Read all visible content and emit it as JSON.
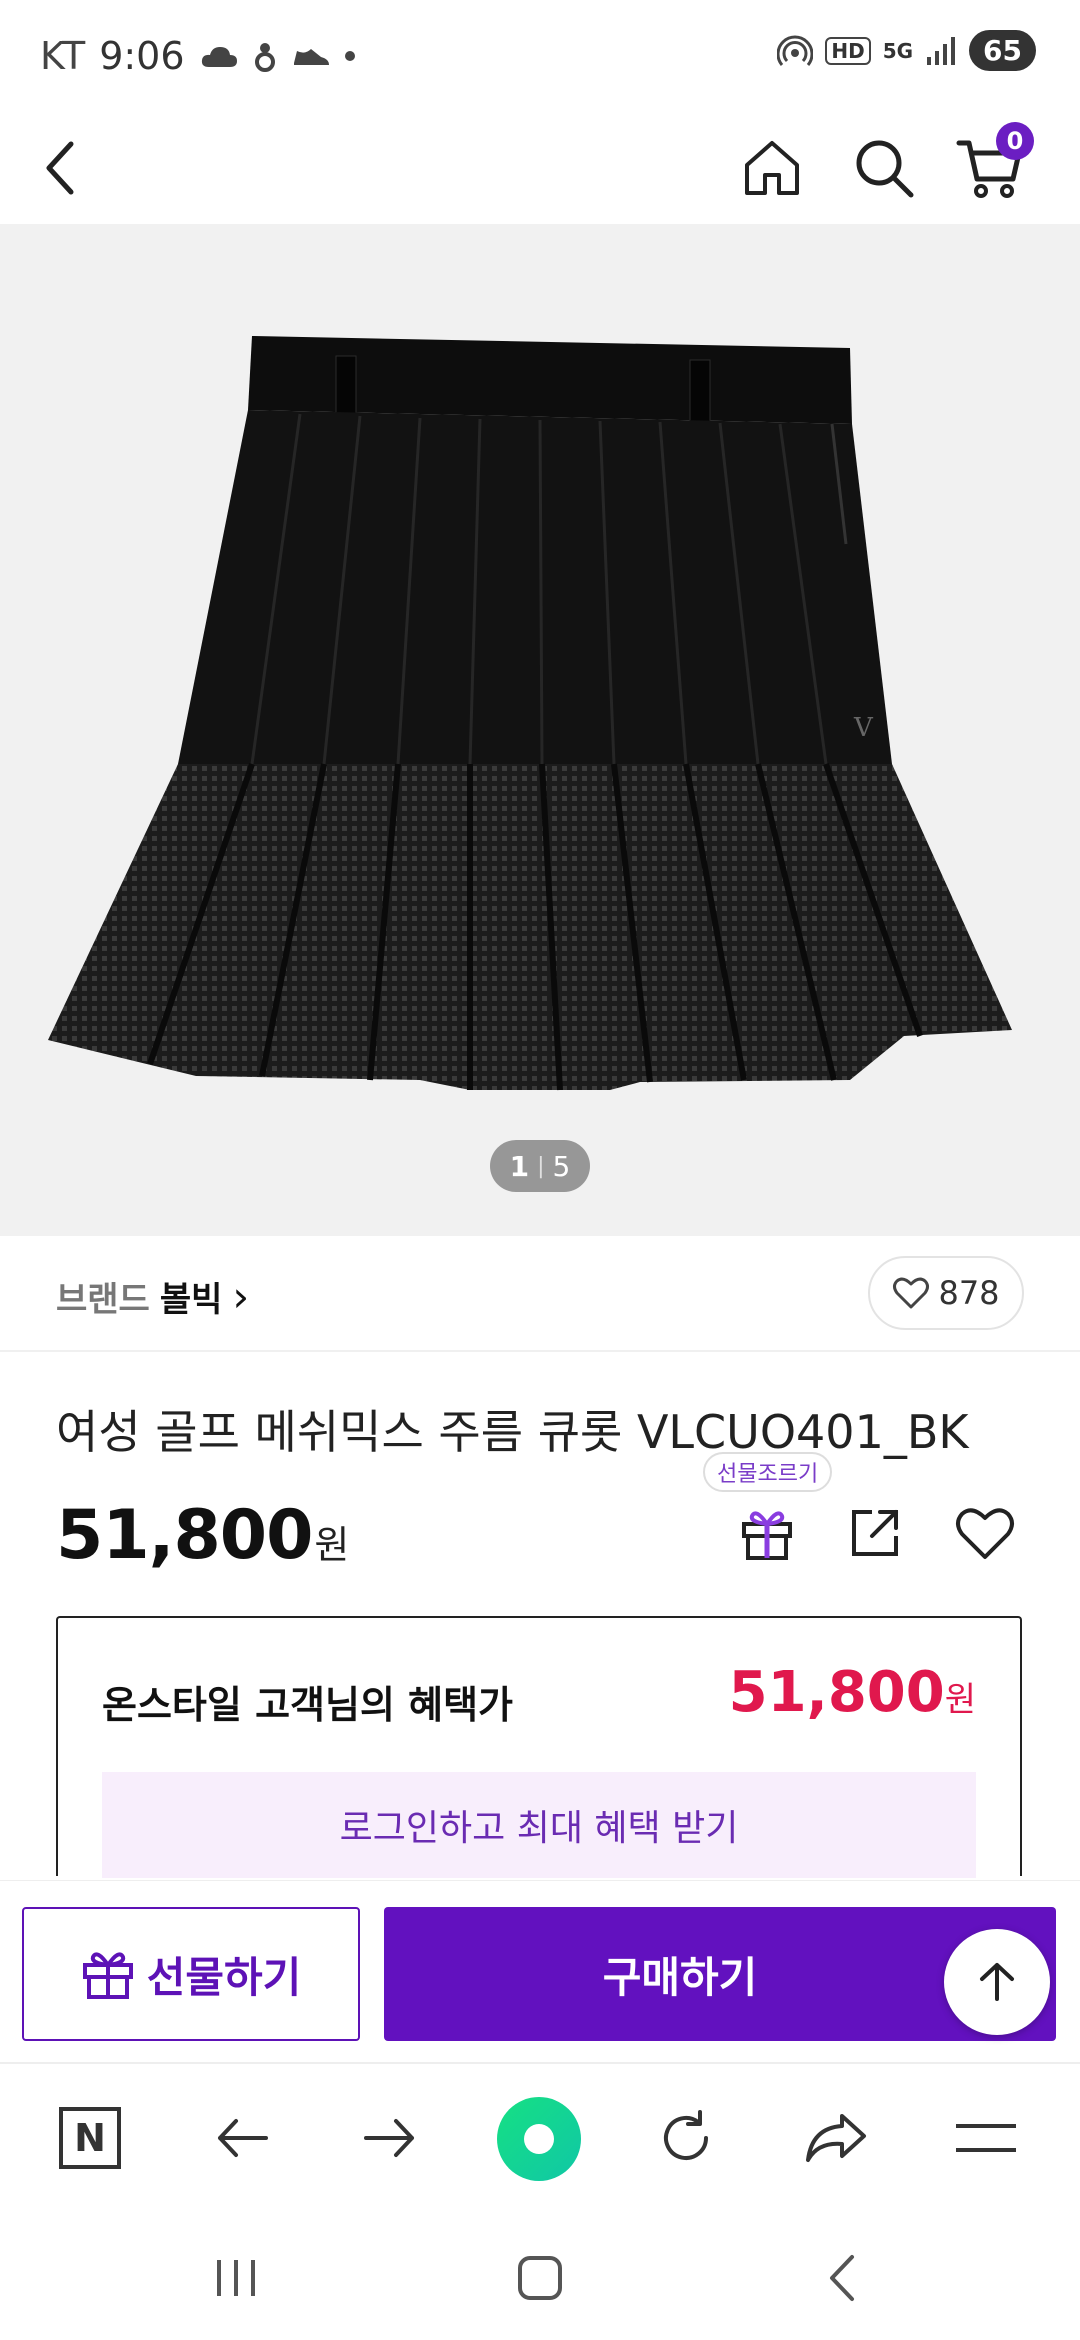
{
  "status_bar": {
    "carrier": "KT",
    "time": "9:06",
    "network_hd": "HD",
    "network_5g": "5G",
    "battery": "65"
  },
  "nav": {
    "cart_count": "0"
  },
  "gallery": {
    "current": "1",
    "separator": "|",
    "total": "5"
  },
  "brand": {
    "label": "브랜드",
    "name": "볼빅",
    "arrow": "›",
    "like_count": "878"
  },
  "product": {
    "title": "여성 골프 메쉬믹스 주름 큐롯 VLCUO401_BK",
    "price": "51,800",
    "currency": "원",
    "gift_tooltip": "선물조르기"
  },
  "benefit": {
    "label": "온스타일 고객님의 혜택가",
    "price": "51,800",
    "currency": "원",
    "login_text": "로그인하고 최대 혜택 받기"
  },
  "actions": {
    "gift_label": "선물하기",
    "buy_label": "구매하기"
  },
  "browser": {
    "logo": "N"
  },
  "colors": {
    "brand_purple": "#6211bf",
    "benefit_red": "#e0184d",
    "benefit_bg": "#f8eefc",
    "naver_green": "#16e083"
  },
  "icons": [
    "cloud-icon",
    "hand-icon",
    "shoe-icon",
    "hotspot-icon",
    "signal-icon",
    "back-icon",
    "home-icon",
    "search-icon",
    "cart-icon",
    "heart-icon",
    "gift-icon",
    "share-icon",
    "arrow-up-icon",
    "arrow-left-icon",
    "arrow-right-icon",
    "refresh-icon",
    "forward-share-icon",
    "menu-icon",
    "recent-apps-icon",
    "home-nav-icon",
    "back-nav-icon"
  ]
}
